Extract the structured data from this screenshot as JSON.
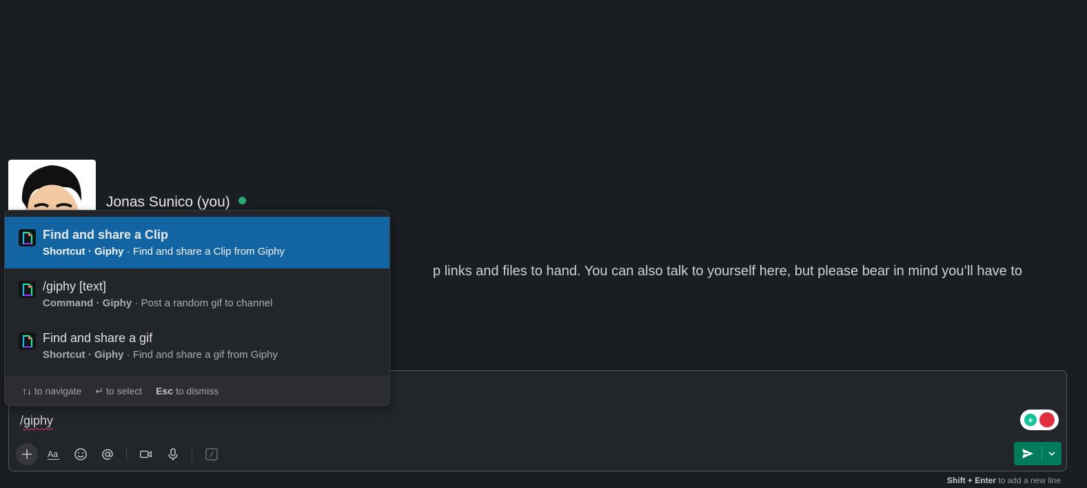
{
  "profile": {
    "name": "Jonas Sunico (you)",
    "status_color": "#2bac76"
  },
  "intro": {
    "text": "p links and files to hand. You can also talk to yourself here, but please bear in mind you’ll have to"
  },
  "popup": {
    "items": [
      {
        "title": "Find and share a Clip",
        "type": "Shortcut · Giphy",
        "desc": "· Find and share a Clip from Giphy",
        "icon": "giphy-icon",
        "selected": true
      },
      {
        "title": "/giphy [text]",
        "type": "Command · Giphy",
        "desc": "· Post a random gif to channel",
        "icon": "giphy-icon",
        "selected": false
      },
      {
        "title": "Find and share a gif",
        "type": "Shortcut · Giphy",
        "desc": "· Find and share a gif from Giphy",
        "icon": "giphy-icon",
        "selected": false
      }
    ],
    "footer": {
      "navigate_arrows": "↑↓",
      "navigate_label": "to navigate",
      "select_key": "↵",
      "select_label": "to select",
      "dismiss_key": "Esc",
      "dismiss_label": "to dismiss"
    }
  },
  "composer": {
    "input_prefix": "/",
    "input_word": "giphy",
    "hint_key": "Shift + Enter",
    "hint_label": "to add a new line"
  },
  "colors": {
    "background": "#1a1d21",
    "selected": "#1264a3",
    "send": "#007a5a"
  }
}
